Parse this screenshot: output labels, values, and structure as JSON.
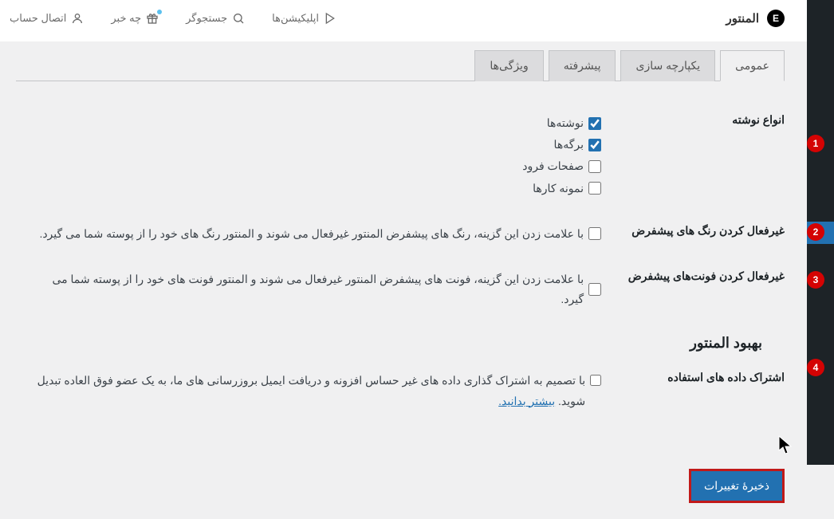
{
  "brand": {
    "name": "المنتور"
  },
  "topmenu": {
    "apps": "اپلیکیشن‌ها",
    "finder": "جستجوگر",
    "whatsnew": "چه خبر",
    "connect": "اتصال حساب"
  },
  "tabs": {
    "general": "عمومی",
    "integrations": "یکپارچه سازی",
    "advanced": "پیشرفته",
    "features": "ویژگی‌ها"
  },
  "labels": {
    "post_types": "انواع نوشته",
    "disable_colors": "غیرفعال کردن رنگ های پیشفرض",
    "disable_fonts": "غیرفعال کردن فونت‌های پیشفرض",
    "improve": "بهبود المنتور",
    "usage": "اشتراک داده های استفاده"
  },
  "options": {
    "posts": "نوشته‌ها",
    "pages": "برگه‌ها",
    "landing": "صفحات فرود",
    "portfolio": "نمونه کارها"
  },
  "descriptions": {
    "disable_colors": "با علامت زدن این گزینه، رنگ های پیشفرض المنتور غیرفعال می شوند و المنتور رنگ های خود را از پوسته شما می گیرد.",
    "disable_fonts": "با علامت زدن این گزینه، فونت های پیشفرض المنتور غیرفعال می شوند و المنتور فونت های خود را از پوسته شما می گیرد.",
    "usage": "با تصمیم به اشتراک گذاری داده های غیر حساس افزونه و دریافت ایمیل بروزرسانی های ما، به یک عضو فوق العاده تبدیل شوید.",
    "learnmore": "بیشتر بدانید."
  },
  "buttons": {
    "save": "ذخیرهٔ تغییرات"
  },
  "badges": {
    "b1": "1",
    "b2": "2",
    "b3": "3",
    "b4": "4"
  }
}
